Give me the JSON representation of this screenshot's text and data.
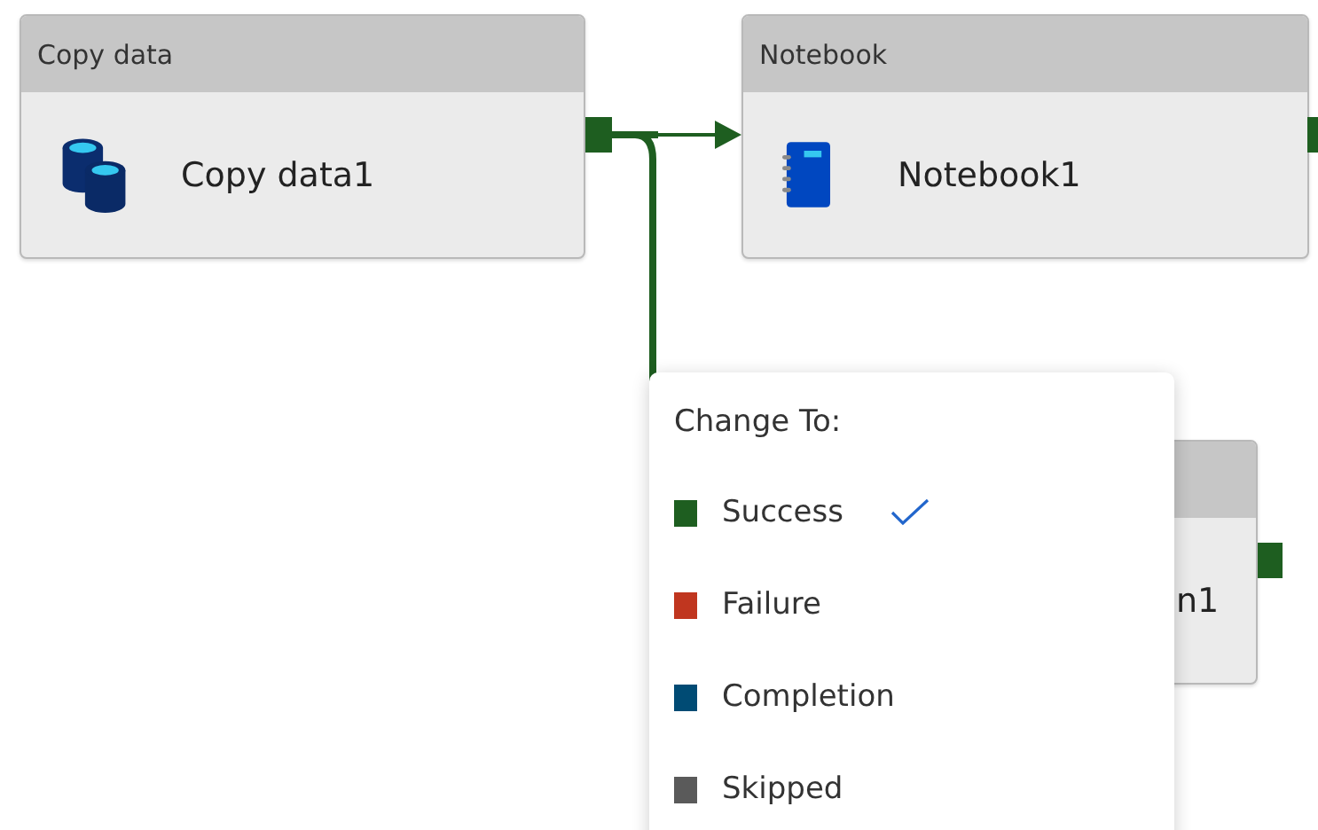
{
  "nodes": [
    {
      "kind": "copy",
      "type": "Copy data",
      "name": "Copy data1"
    },
    {
      "kind": "notebook",
      "type": "Notebook",
      "name": "Notebook1"
    },
    {
      "kind": "hidden",
      "name": "n1"
    }
  ],
  "menu": {
    "title": "Change To:",
    "options": [
      {
        "label": "Success",
        "color": "#1e5e20",
        "selected": true
      },
      {
        "label": "Failure",
        "color": "#c0361f",
        "selected": false
      },
      {
        "label": "Completion",
        "color": "#004b74",
        "selected": false
      },
      {
        "label": "Skipped",
        "color": "#5a5a5a",
        "selected": false
      }
    ]
  }
}
